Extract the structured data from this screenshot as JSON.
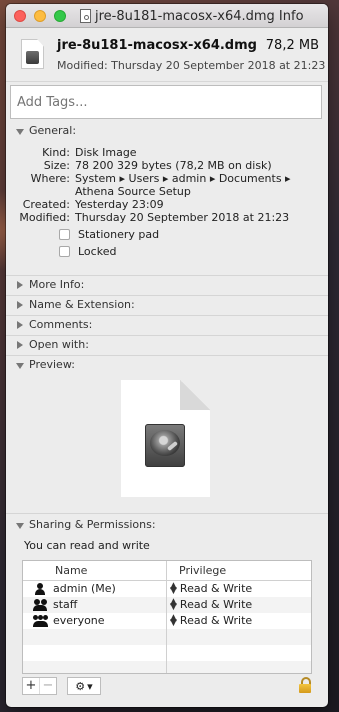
{
  "window": {
    "title": "jre-8u181-macosx-x64.dmg Info"
  },
  "file": {
    "name": "jre-8u181-macosx-x64.dmg",
    "size": "78,2 MB",
    "modified_line": "Modified: Thursday 20 September 2018 at 21:23"
  },
  "tags": {
    "placeholder": "Add Tags..."
  },
  "sections": {
    "general": "General:",
    "more_info": "More Info:",
    "name_extension": "Name & Extension:",
    "comments": "Comments:",
    "open_with": "Open with:",
    "preview": "Preview:",
    "sharing": "Sharing & Permissions:"
  },
  "general": {
    "kind_label": "Kind:",
    "kind": "Disk Image",
    "size_label": "Size:",
    "size": "78 200 329 bytes (78,2 MB on disk)",
    "where_label": "Where:",
    "where_line1": "System ▸ Users ▸ admin ▸ Documents ▸",
    "where_line2": "Athena Source Setup",
    "created_label": "Created:",
    "created": "Yesterday 23:09",
    "modified_label": "Modified:",
    "modified": "Thursday 20 September 2018 at 21:23",
    "stationery_pad": "Stationery pad",
    "locked": "Locked"
  },
  "sharing": {
    "access_text": "You can read and write",
    "col_name": "Name",
    "col_privilege": "Privilege",
    "rows": [
      {
        "name": "admin (Me)",
        "privilege": "Read & Write",
        "icon": "user-icon"
      },
      {
        "name": "staff",
        "privilege": "Read & Write",
        "icon": "group-icon"
      },
      {
        "name": "everyone",
        "privilege": "Read & Write",
        "icon": "everyone-icon"
      }
    ]
  },
  "toolbar": {
    "add": "+",
    "remove": "−",
    "action": "⚙"
  }
}
